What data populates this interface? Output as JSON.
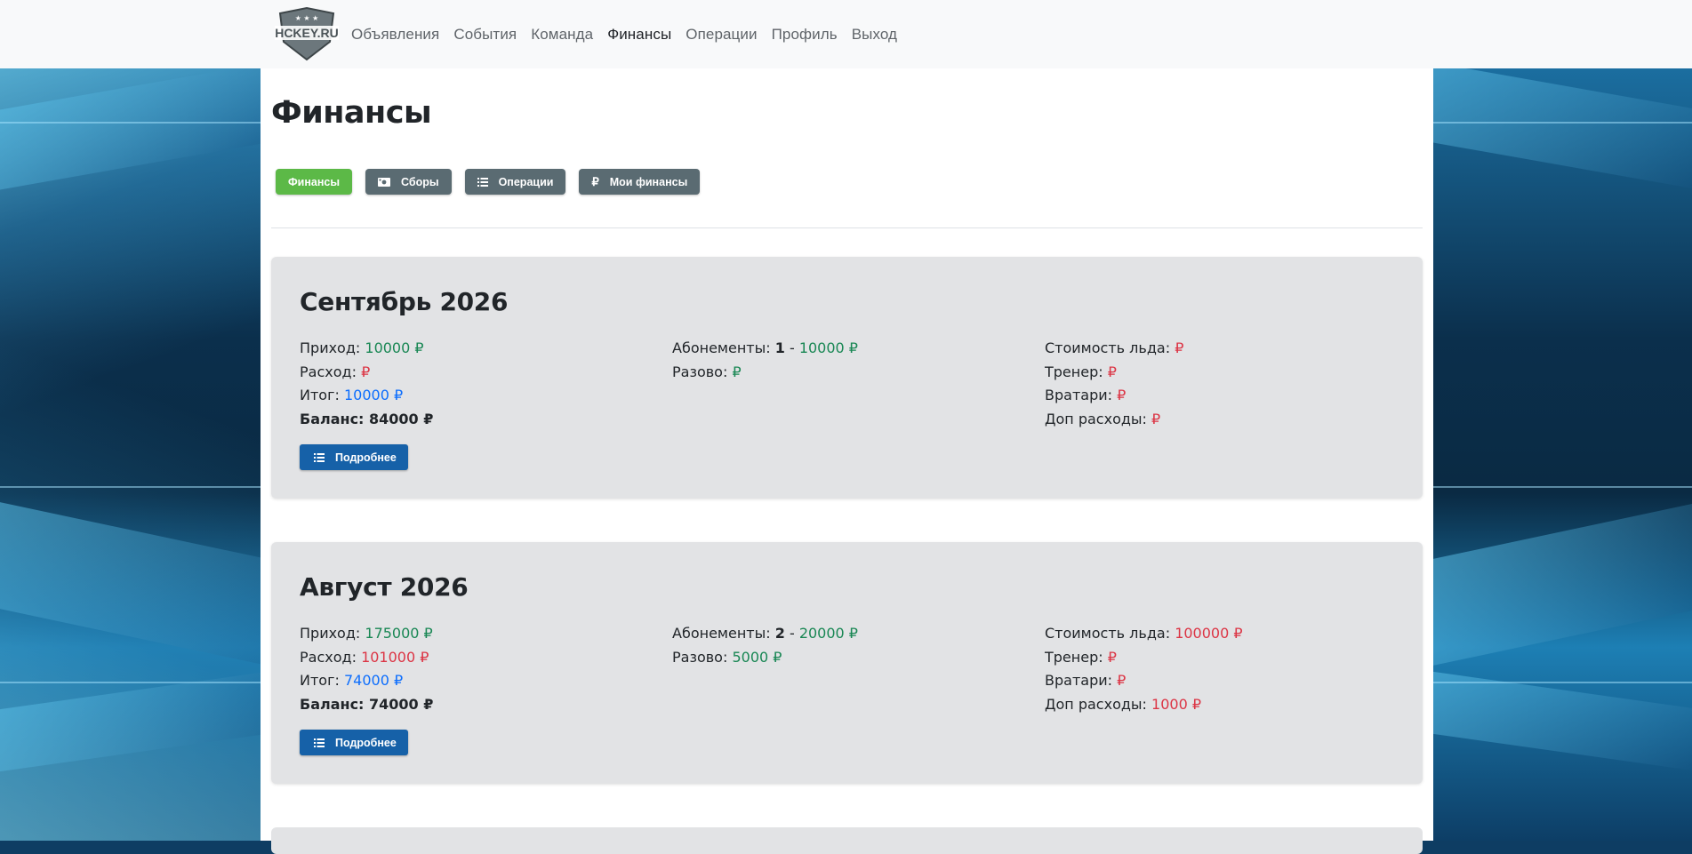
{
  "nav": {
    "logo_text": "HCKEY.RU",
    "links": [
      "Объявления",
      "События",
      "Команда",
      "Финансы",
      "Операции",
      "Профиль",
      "Выход"
    ],
    "active_link": "Финансы"
  },
  "page": {
    "title": "Финансы"
  },
  "tabs": [
    {
      "label": "Финансы",
      "icon": null
    },
    {
      "label": "Сборы",
      "icon": "money-icon"
    },
    {
      "label": "Операции",
      "icon": "list-icon"
    },
    {
      "label": "Мои финансы",
      "icon": "ruble-icon"
    }
  ],
  "colors": {
    "green_button": "#5cb947",
    "gray_button": "#5a6b72",
    "blue_button": "#1661a8",
    "income": "#198754",
    "expense": "#dc3545",
    "total": "#0d6efd"
  },
  "months": [
    {
      "title": "Сентябрь 2026",
      "income_label": "Приход:",
      "income_value": "10000 ₽",
      "expense_label": "Расход:",
      "expense_value": "₽",
      "total_label": "Итог:",
      "total_value": "10000 ₽",
      "balance": "Баланс: 84000 ₽",
      "subs_label": "Абонементы:",
      "subs_count": "1",
      "subs_sep": " - ",
      "subs_value": "10000 ₽",
      "once_label": "Разово:",
      "once_value": "₽",
      "ice_label": "Стоимость льда:",
      "ice_value": "₽",
      "coach_label": "Тренер:",
      "coach_value": "₽",
      "goalies_label": "Вратари:",
      "goalies_value": "₽",
      "extra_label": "Доп расходы:",
      "extra_value": "₽",
      "more_label": "Подробнее"
    },
    {
      "title": "Август 2026",
      "income_label": "Приход:",
      "income_value": "175000 ₽",
      "expense_label": "Расход:",
      "expense_value": "101000 ₽",
      "total_label": "Итог:",
      "total_value": "74000 ₽",
      "balance": "Баланс: 74000 ₽",
      "subs_label": "Абонементы:",
      "subs_count": "2",
      "subs_sep": " - ",
      "subs_value": "20000 ₽",
      "once_label": "Разово:",
      "once_value": "5000 ₽",
      "ice_label": "Стоимость льда:",
      "ice_value": "100000 ₽",
      "coach_label": "Тренер:",
      "coach_value": "₽",
      "goalies_label": "Вратари:",
      "goalies_value": "₽",
      "extra_label": "Доп расходы:",
      "extra_value": "1000 ₽",
      "more_label": "Подробнее"
    }
  ]
}
